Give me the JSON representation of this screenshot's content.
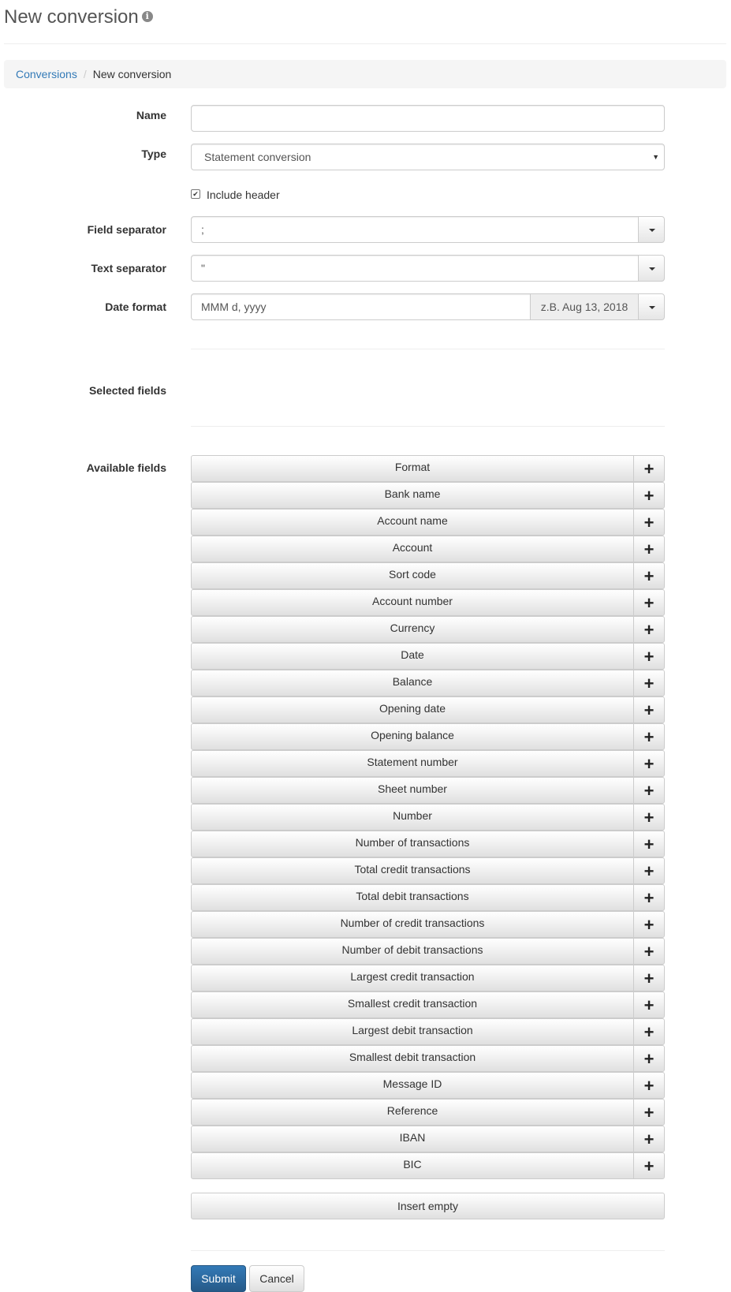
{
  "header": {
    "title": "New conversion",
    "info_icon": "info-circle-icon"
  },
  "breadcrumb": {
    "link": "Conversions",
    "separator": "/",
    "current": "New conversion"
  },
  "form": {
    "name_label": "Name",
    "name_value": "",
    "type_label": "Type",
    "type_value": "Statement conversion",
    "include_header_label": "Include header",
    "include_header_checked": true,
    "field_separator_label": "Field separator",
    "field_separator_value": ";",
    "text_separator_label": "Text separator",
    "text_separator_value": "\"",
    "date_format_label": "Date format",
    "date_format_value": "MMM d, yyyy",
    "date_format_example": "z.B. Aug 13, 2018",
    "selected_fields_label": "Selected fields",
    "available_fields_label": "Available fields"
  },
  "available_fields": [
    "Format",
    "Bank name",
    "Account name",
    "Account",
    "Sort code",
    "Account number",
    "Currency",
    "Date",
    "Balance",
    "Opening date",
    "Opening balance",
    "Statement number",
    "Sheet number",
    "Number",
    "Number of transactions",
    "Total credit transactions",
    "Total debit transactions",
    "Number of credit transactions",
    "Number of debit transactions",
    "Largest credit transaction",
    "Smallest credit transaction",
    "Largest debit transaction",
    "Smallest debit transaction",
    "Message ID",
    "Reference",
    "IBAN",
    "BIC"
  ],
  "add_symbol": "+",
  "insert_empty_label": "Insert empty",
  "actions": {
    "submit": "Submit",
    "cancel": "Cancel"
  },
  "colors": {
    "primary": "#337ab7",
    "link": "#337ab7"
  }
}
